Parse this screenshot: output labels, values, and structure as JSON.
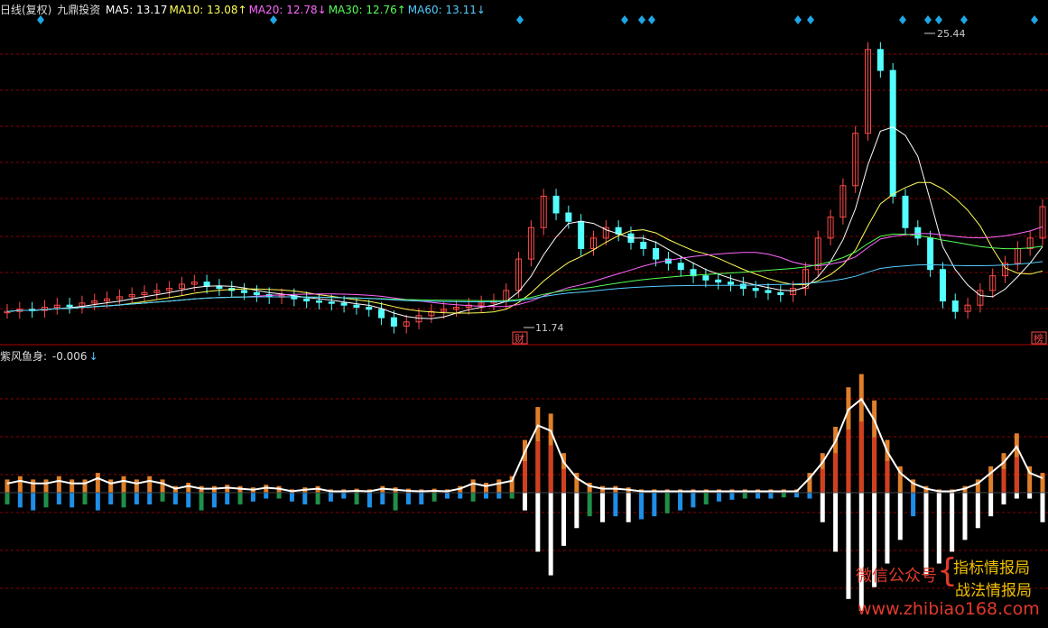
{
  "header": {
    "title": "日线(复权)",
    "stock": "九鼎投资",
    "ma": [
      {
        "label": "MA5:",
        "value": "13.17",
        "arrow": "",
        "color": "#ffffff"
      },
      {
        "label": "MA10:",
        "value": "13.08",
        "arrow": "↑",
        "color": "#ffff55"
      },
      {
        "label": "MA20:",
        "value": "12.78",
        "arrow": "↓",
        "color": "#ff66ff"
      },
      {
        "label": "MA30:",
        "value": "12.76",
        "arrow": "↑",
        "color": "#55ff55"
      },
      {
        "label": "MA60:",
        "value": "13.11",
        "arrow": "↓",
        "color": "#55ccff"
      }
    ]
  },
  "indicator": {
    "label": "紫风鱼身:",
    "value": "-0.006",
    "arrow": "↓"
  },
  "annotations": {
    "high": "25.44",
    "low": "11.74",
    "tag_cai": "财",
    "tag_bang": "榜"
  },
  "watermark": {
    "line1": "微信公众号",
    "line2": "指标情报局",
    "line3": "战法情报局",
    "url": "www.zhibiao168.com",
    "brace": "{"
  },
  "colors": {
    "up": "#ff4a4a",
    "down": "#54ffff",
    "grid": "#8b0000",
    "pos_bar": "#e07f2a",
    "neg_bar_white": "#ffffff",
    "neg_bar_blue": "#1e8fe6",
    "neg_bar_green": "#1f8f4a"
  },
  "chart_data": [
    {
      "type": "candlestick",
      "title": "日线(复权) 九鼎投资",
      "series": [
        {
          "name": "MA5",
          "color": "#ffffff"
        },
        {
          "name": "MA10",
          "color": "#ffff55"
        },
        {
          "name": "MA20",
          "color": "#ff66ff"
        },
        {
          "name": "MA30",
          "color": "#55ff55"
        },
        {
          "name": "MA60",
          "color": "#55ccff"
        }
      ],
      "close": [
        12.5,
        12.6,
        12.55,
        12.7,
        12.8,
        12.75,
        12.9,
        13.0,
        13.1,
        13.2,
        13.3,
        13.4,
        13.5,
        13.6,
        13.8,
        13.9,
        13.7,
        13.6,
        13.5,
        13.4,
        13.3,
        13.2,
        13.25,
        13.1,
        13.0,
        12.95,
        12.9,
        12.8,
        12.7,
        12.6,
        12.2,
        11.8,
        12.0,
        12.3,
        12.5,
        12.6,
        12.7,
        12.8,
        12.9,
        13.0,
        13.5,
        15.0,
        16.5,
        18.0,
        17.2,
        16.8,
        15.5,
        16.0,
        16.5,
        16.2,
        15.8,
        15.5,
        15.0,
        14.8,
        14.5,
        14.2,
        14.0,
        13.9,
        13.8,
        13.6,
        13.5,
        13.4,
        13.3,
        13.6,
        14.5,
        16.0,
        17.0,
        18.5,
        21.0,
        25.0,
        24.0,
        18.0,
        16.5,
        16.0,
        14.5,
        13.0,
        12.5,
        12.8,
        13.5,
        14.2,
        14.8,
        15.5,
        16.0,
        17.5
      ],
      "ylim": [
        11.0,
        26.5
      ],
      "annotations": [
        {
          "label": "25.44",
          "type": "high"
        },
        {
          "label": "11.74",
          "type": "low"
        }
      ]
    },
    {
      "type": "bar",
      "title": "紫风鱼身",
      "last_value": -0.006,
      "pos_values": [
        0.2,
        0.25,
        0.2,
        0.2,
        0.25,
        0.2,
        0.2,
        0.3,
        0.2,
        0.25,
        0.2,
        0.25,
        0.2,
        0.1,
        0.15,
        0.1,
        0.1,
        0.12,
        0.1,
        0.08,
        0.12,
        0.1,
        0.05,
        0.08,
        0.1,
        0.05,
        0.05,
        0.06,
        0.05,
        0.1,
        0.08,
        0.06,
        0.05,
        0.06,
        0.05,
        0.1,
        0.2,
        0.15,
        0.2,
        0.25,
        0.8,
        1.3,
        1.2,
        0.6,
        0.3,
        0.15,
        0.1,
        0.1,
        0.08,
        0.05,
        0.05,
        0.05,
        0.05,
        0.05,
        0.05,
        0.05,
        0.05,
        0.05,
        0.05,
        0.05,
        0.05,
        0.05,
        0.3,
        0.6,
        1.0,
        1.6,
        1.8,
        1.4,
        0.8,
        0.4,
        0.2,
        0.1,
        0.05,
        0.05,
        0.1,
        0.2,
        0.4,
        0.6,
        0.9,
        0.4,
        0.3
      ],
      "neg_values": [
        -0.2,
        -0.25,
        -0.3,
        -0.25,
        -0.2,
        -0.25,
        -0.2,
        -0.3,
        -0.2,
        -0.25,
        -0.2,
        -0.2,
        -0.15,
        -0.2,
        -0.25,
        -0.3,
        -0.25,
        -0.2,
        -0.2,
        -0.15,
        -0.1,
        -0.1,
        -0.15,
        -0.2,
        -0.2,
        -0.15,
        -0.1,
        -0.2,
        -0.25,
        -0.2,
        -0.3,
        -0.2,
        -0.2,
        -0.15,
        -0.1,
        -0.1,
        -0.15,
        -0.1,
        -0.1,
        -0.1,
        -0.3,
        -1.0,
        -1.4,
        -0.9,
        -0.6,
        -0.4,
        -0.5,
        -0.4,
        -0.5,
        -0.45,
        -0.4,
        -0.35,
        -0.3,
        -0.25,
        -0.2,
        -0.15,
        -0.12,
        -0.1,
        -0.1,
        -0.1,
        -0.08,
        -0.08,
        -0.1,
        -0.5,
        -1.0,
        -1.8,
        -2.0,
        -1.6,
        -1.2,
        -0.8,
        -0.4,
        -1.4,
        -1.2,
        -1.0,
        -0.8,
        -0.6,
        -0.4,
        -0.2,
        -0.1,
        -0.1,
        -0.5,
        -0.3
      ],
      "ylim": [
        -2.2,
        2.0
      ]
    }
  ]
}
